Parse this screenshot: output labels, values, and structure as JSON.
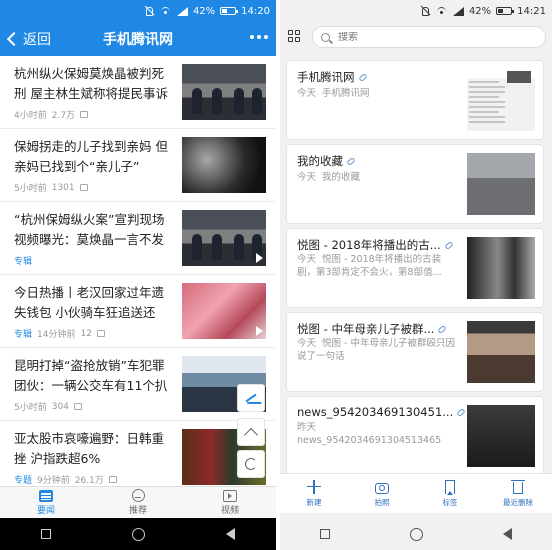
{
  "left": {
    "status": {
      "battery": "42%",
      "time": "14:20"
    },
    "nav": {
      "back_label": "返回",
      "title": "手机腾讯网"
    },
    "news": [
      {
        "title": "杭州纵火保姆莫焕晶被判死刑 屋主林生斌称将提民事诉讼",
        "time": "4小时前",
        "count": "2.7万",
        "tag": "",
        "has_video": false,
        "thumb": "court"
      },
      {
        "title": "保姆拐走的儿子找到亲妈 但亲妈已找到个“亲儿子”",
        "time": "5小时前",
        "count": "1301",
        "tag": "",
        "has_video": false,
        "thumb": "dark"
      },
      {
        "title": "“杭州保姆纵火案”宣判现场视频曝光：莫焕晶一言不发",
        "time": "",
        "count": "",
        "tag": "专辑",
        "has_video": true,
        "thumb": "court"
      },
      {
        "title": "今日热播丨老汉回家过年遗失钱包 小伙骑车狂追送还",
        "time": "14分钟前",
        "count": "12",
        "tag": "专辑",
        "has_video": true,
        "thumb": "money"
      },
      {
        "title": "昆明打掉“盗抢放销”车犯罪团伙：一辆公交车有11个扒手",
        "time": "5小时前",
        "count": "304",
        "tag": "",
        "has_video": false,
        "thumb": "bus"
      },
      {
        "title": "亚太股市哀嚎遍野：日韩重挫 沪指跌超6%",
        "time": "9分钟前",
        "count": "26.1万",
        "tag": "专题",
        "has_video": false,
        "thumb": "stock"
      }
    ],
    "tabs": [
      {
        "label": "要闻",
        "active": true
      },
      {
        "label": "推荐",
        "active": false
      },
      {
        "label": "视频",
        "active": false
      }
    ]
  },
  "right": {
    "status": {
      "battery": "42%",
      "time": "14:21"
    },
    "search": {
      "placeholder": "搜索"
    },
    "cards": [
      {
        "title": "手机腾讯网",
        "date": "今天",
        "desc": "手机腾讯网",
        "thumb": "news"
      },
      {
        "title": "我的收藏",
        "date": "今天",
        "desc": "我的收藏",
        "thumb": "person"
      },
      {
        "title": "悦图 - 2018年将播出的古...",
        "date": "今天",
        "desc": "悦图 - 2018年将播出的古装剧，第3部肯定不会火，第8部值...",
        "thumb": "bw"
      },
      {
        "title": "悦图 - 中年母亲儿子被群...",
        "date": "今天",
        "desc": "悦图 - 中年母亲儿子被群殴只因说了一句话",
        "thumb": "crowd"
      },
      {
        "title": "news_954203469130451...",
        "date": "昨天",
        "desc": "news_9542034691304513465",
        "thumb": "mini"
      }
    ],
    "actions": [
      {
        "label": "新建",
        "icon": "plus-icon"
      },
      {
        "label": "拍照",
        "icon": "camera-icon"
      },
      {
        "label": "标签",
        "icon": "tag-icon"
      },
      {
        "label": "最近删除",
        "icon": "trash-icon"
      }
    ]
  },
  "colors": {
    "brand_blue": "#1f88e5",
    "action_blue": "#2f6fbd"
  }
}
